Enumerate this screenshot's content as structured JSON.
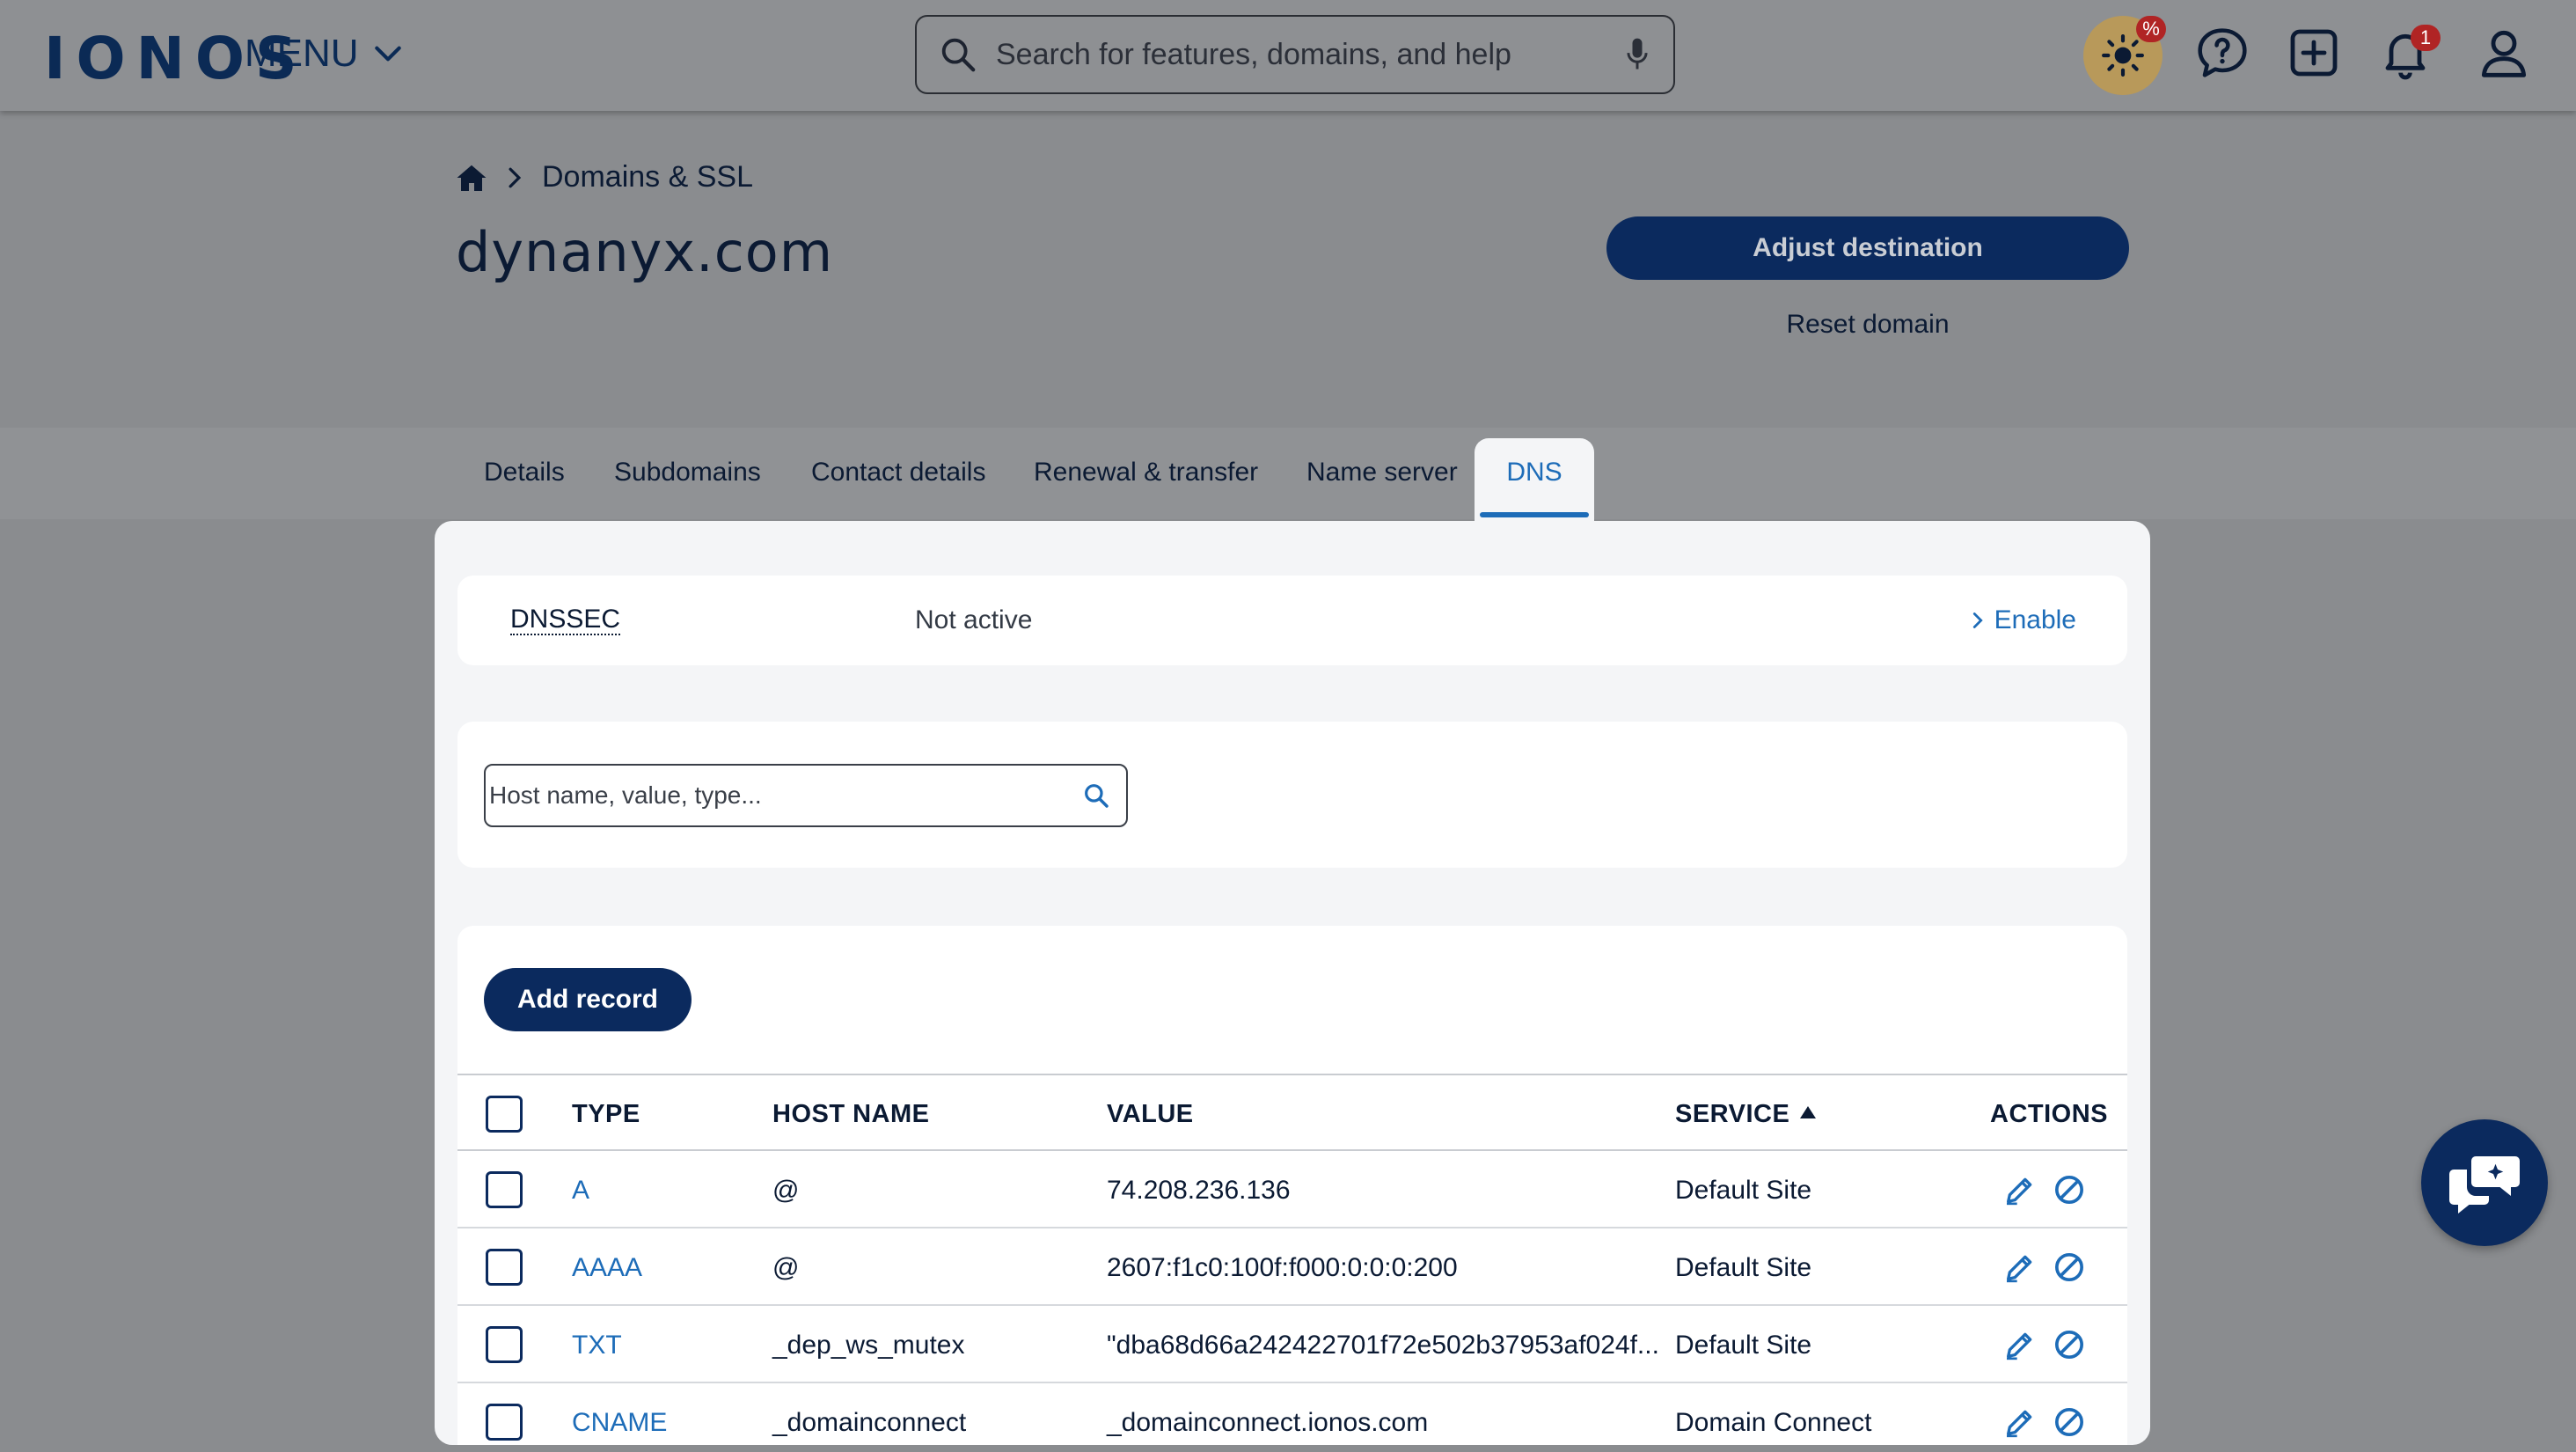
{
  "header": {
    "logo": "IONOS",
    "menu_label": "MENU",
    "search_placeholder": "Search for features, domains, and help",
    "offers_badge": "%",
    "notifications_badge": "1"
  },
  "breadcrumb": {
    "section": "Domains & SSL"
  },
  "domain": {
    "title": "dynanyx.com",
    "adjust_label": "Adjust destination",
    "reset_label": "Reset domain"
  },
  "tabs": [
    "Details",
    "Subdomains",
    "Contact details",
    "Renewal & transfer",
    "Name server",
    "DNS"
  ],
  "active_tab": "DNS",
  "dnssec": {
    "label": "DNSSEC",
    "status": "Not active",
    "action": "Enable"
  },
  "filter": {
    "placeholder": "Host name, value, type..."
  },
  "records": {
    "add_label": "Add record",
    "columns": {
      "type": "TYPE",
      "host": "HOST NAME",
      "value": "VALUE",
      "service": "SERVICE",
      "actions": "ACTIONS"
    },
    "rows": [
      {
        "type": "A",
        "host": "@",
        "value": "74.208.236.136",
        "service": "Default Site"
      },
      {
        "type": "AAAA",
        "host": "@",
        "value": "2607:f1c0:100f:f000:0:0:0:200",
        "service": "Default Site"
      },
      {
        "type": "TXT",
        "host": "_dep_ws_mutex",
        "value": "\"dba68d66a242422701f72e502b37953af024f...",
        "service": "Default Site"
      },
      {
        "type": "CNAME",
        "host": "_domainconnect",
        "value": "_domainconnect.ionos.com",
        "service": "Domain Connect"
      }
    ]
  },
  "colors": {
    "brand": "#0b2a5e",
    "link": "#1d6cb8",
    "overlay": "#8a8c8f"
  }
}
